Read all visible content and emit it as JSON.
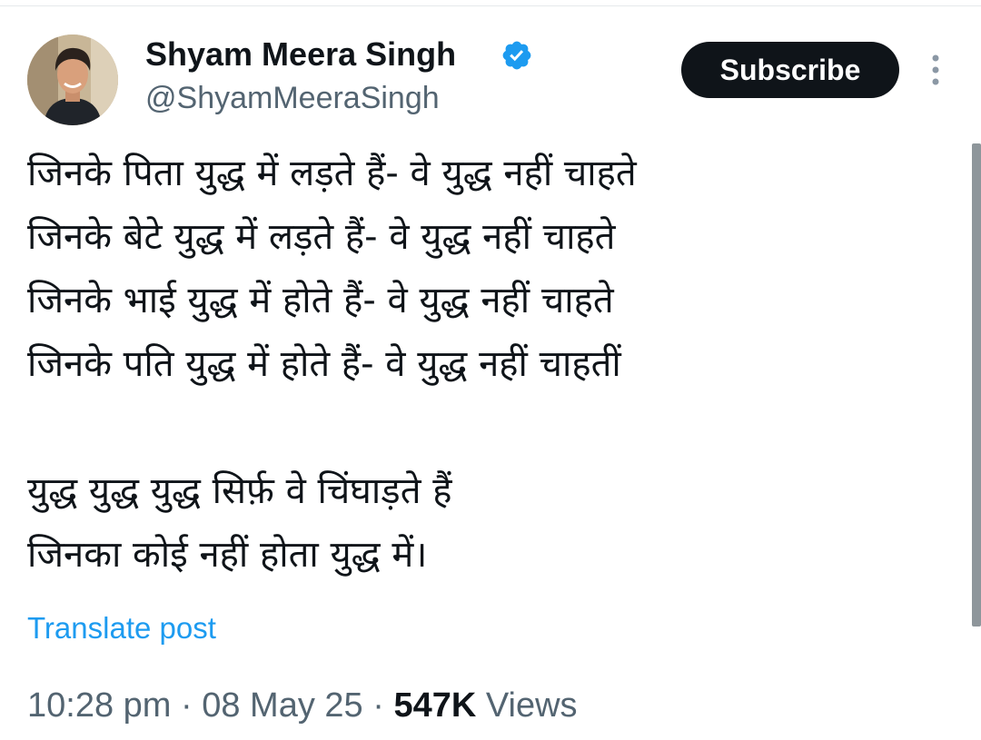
{
  "author": {
    "display_name": "Shyam Meera Singh",
    "handle": "@ShyamMeeraSingh",
    "verified": true,
    "avatar_icon": "profile-photo"
  },
  "actions": {
    "subscribe_label": "Subscribe",
    "more_icon": "vertical-ellipsis-icon"
  },
  "post": {
    "lines": [
      "जिनके पिता युद्ध में लड़ते हैं- वे युद्ध नहीं चाहते",
      "जिनके बेटे युद्ध में लड़ते हैं- वे युद्ध नहीं चाहते",
      "जिनके भाई युद्ध में होते हैं- वे युद्ध नहीं चाहते",
      "जिनके पति युद्ध में होते हैं- वे युद्ध नहीं चाहतीं",
      "",
      "युद्ध युद्ध युद्ध सिर्फ़ वे चिंघाड़ते हैं",
      "जिनका कोई नहीं होता युद्ध में।"
    ],
    "translate_label": "Translate post"
  },
  "meta": {
    "time": "10:28 pm",
    "separator": " · ",
    "date": "08 May 25",
    "views_count": "547K",
    "views_label": " Views"
  },
  "colors": {
    "text_primary": "#0f1419",
    "text_secondary": "#536471",
    "link": "#1d9bf0",
    "verified_badge": "#1d9bf0"
  }
}
